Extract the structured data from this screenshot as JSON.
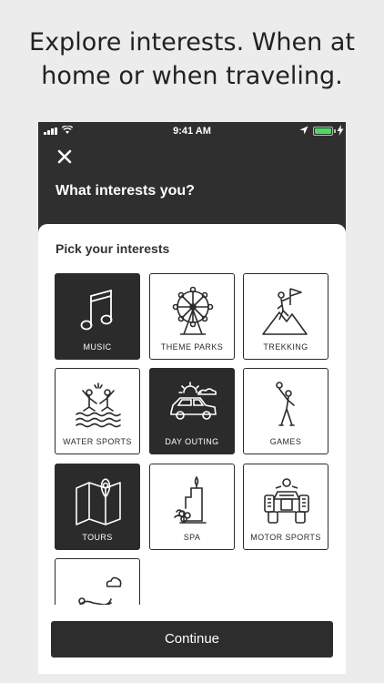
{
  "headline": {
    "line1": "Explore interests. When at",
    "line2": "home or when traveling."
  },
  "status_bar": {
    "time": "9:41 AM",
    "signal_icon": "cellular-signal-icon",
    "wifi_icon": "wifi-icon",
    "location_icon": "location-arrow-icon",
    "battery_icon": "battery-icon",
    "charging_icon": "charging-bolt-icon",
    "battery_level": 1.0,
    "battery_color": "#4cd964"
  },
  "header": {
    "close_icon": "close-icon",
    "title": "What interests you?",
    "background": "#2f2f2f"
  },
  "sheet": {
    "title": "Pick your interests"
  },
  "interests": [
    {
      "label": "MUSIC",
      "icon": "music-note-icon",
      "selected": true
    },
    {
      "label": "THEME PARKS",
      "icon": "ferris-wheel-icon",
      "selected": false
    },
    {
      "label": "TREKKING",
      "icon": "climber-flag-icon",
      "selected": false
    },
    {
      "label": "WATER SPORTS",
      "icon": "water-sports-icon",
      "selected": false
    },
    {
      "label": "DAY OUTING",
      "icon": "car-outing-icon",
      "selected": true
    },
    {
      "label": "GAMES",
      "icon": "ball-player-icon",
      "selected": false
    },
    {
      "label": "TOURS",
      "icon": "map-pin-icon",
      "selected": true
    },
    {
      "label": "SPA",
      "icon": "spa-candle-icon",
      "selected": false
    },
    {
      "label": "MOTOR SPORTS",
      "icon": "atv-quad-icon",
      "selected": false
    },
    {
      "label": "",
      "icon": "relax-hand-icon",
      "selected": false
    }
  ],
  "footer": {
    "continue_label": "Continue"
  }
}
